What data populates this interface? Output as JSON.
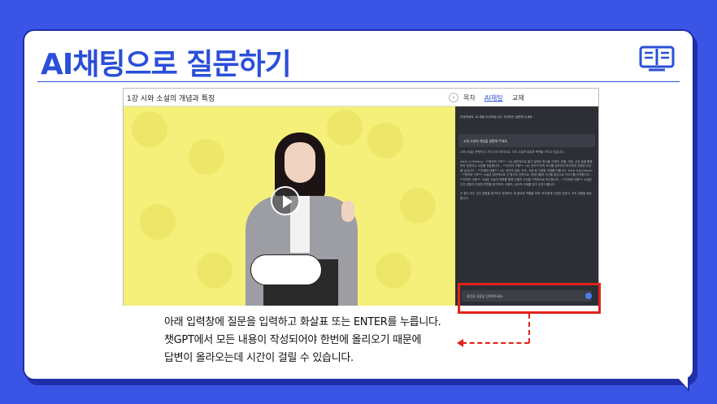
{
  "slide": {
    "title": "AI채팅으로 질문하기",
    "caption_lines": [
      "아래 입력창에 질문을 입력하고 화살표 또는 ENTER를 누릅니다.",
      "챗GPT에서 모든 내용이 작성되어야 한번에 올리오기 때문에",
      "답변이 올라오는데 시간이 걸릴 수 있습니다."
    ]
  },
  "app": {
    "lesson_title": "1강 시와 소설의 개념과 특징",
    "tabs": [
      "목차",
      "AI채팅",
      "교재"
    ],
    "active_tab": "AI채팅"
  },
  "chat": {
    "greeting": "안녕하세요, AI 채팅 도우미입니다. 무엇이든 질문해 주세요.",
    "user_question": "시와 소설의 개념을 설명해 주세요.",
    "answer_intro": "시와 소설은 문학의 두 가지 주요 형식으로, 각각 고유한 특징과 목적을 가지고 있습니다.",
    "answer_body": "### 시 (Poetry) - **정의와 구조**: 시는 일반적으로 짧고 압축된 형식을 가지며, 운율, 리듬, 은유 등을 활용하여 감정이나 사상을 전달합니다. - **언어의 사용**: 시는 언어의 미적 요소를 강조하여 독자에게 강렬한 인상을 남깁니다. - **주제와 내용**: 시는 개인적 감정, 자연, 사랑 등 다양한 주제를 다룹니다. ### 소설 (Novel) - **정의와 구조**: 소설은 일반적으로 긴 형식의 산문으로, 등장인물과 사건을 중심으로 이야기를 전개합니다. - **언어의 사용**: 소설은 서술과 대화를 통해 인물과 사건을 구체적으로 묘사합니다. - **주제와 내용**: 소설은 인간 경험의 다양한 측면을 탐구하며, 사회적, 심리적 주제를 깊이 있게 다룹니다.",
    "answer_outro": "두 형식 모두 인간 경험을 탐구하고 표현하는 데 중요한 역할을 하며, 독자에게 다양한 감정적, 지적 경험을 제공합니다.",
    "input_placeholder": "질문을 내용을 입력해주세요."
  },
  "colors": {
    "background": "#3a55e6",
    "accent": "#2a4fd8",
    "highlight": "#e2231a",
    "video_bg": "#f4f07a",
    "chat_bg": "#2d2f35"
  }
}
